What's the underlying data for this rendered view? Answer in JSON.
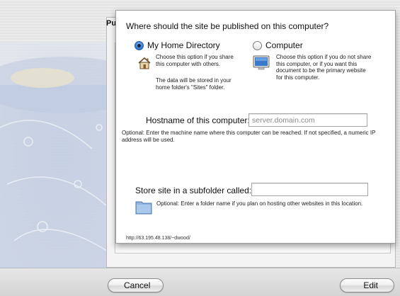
{
  "window": {
    "partial_title": "Pu",
    "cancel_label": "Cancel",
    "edit_label": "Edit"
  },
  "sheet": {
    "question": "Where should the site be published on this computer?",
    "options": [
      {
        "label": "My Home Directory",
        "selected": true,
        "icon": "home-folder-icon",
        "desc1": "Choose this option if you share this computer with others.",
        "desc2": "The data will be stored in your home folder's \"Sites\" folder."
      },
      {
        "label": "Computer",
        "selected": false,
        "icon": "computer-monitor-icon",
        "desc1": "Choose this option if you do not share this computer, or if you want this document to be the primary website for this computer."
      }
    ],
    "hostname": {
      "label": "Hostname of this computer:",
      "placeholder": "server.domain.com",
      "help": "Optional: Enter the machine name where this computer can be reached.  If not specified, a numeric IP address will be used."
    },
    "subfolder": {
      "label": "Store site in a subfolder called:",
      "value": "",
      "icon": "folder-icon",
      "help": "Optional: Enter a folder name if you plan on hosting other websites in this location."
    },
    "url": "http://63.195.48.138/~dwood/"
  },
  "colors": {
    "radio_selected": "#3b7fd0",
    "field_border": "#a6a6a6",
    "background_art": "#2f5fb0"
  }
}
